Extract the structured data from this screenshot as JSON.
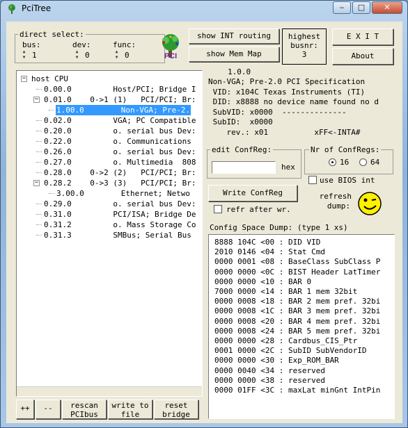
{
  "window": {
    "title": "PciTree",
    "minimize": "‒",
    "maximize": "□",
    "close": "✕"
  },
  "direct_select": {
    "title": "direct select:",
    "bus": {
      "label": "bus:",
      "value": "1"
    },
    "dev": {
      "label": "dev:",
      "value": "0"
    },
    "func": {
      "label": "func:",
      "value": "0"
    }
  },
  "logo_text": "PCI",
  "buttons": {
    "show_int": "show INT routing",
    "show_mem": "show Mem Map",
    "highest_busnr_line1": "highest",
    "highest_busnr_line2": "busnr:",
    "highest_busnr_value": "3",
    "exit": "E X I T",
    "about": "About"
  },
  "tree": [
    {
      "indent": 0,
      "expander": "−",
      "text": "host CPU"
    },
    {
      "indent": 1,
      "text": "0.00.0         Host/PCI; Bridge I"
    },
    {
      "indent": 1,
      "expander": "−",
      "text": "0.01.0    0->1 (1)   PCI/PCI; Br:"
    },
    {
      "indent": 2,
      "text": "1.00.0        Non-VGA; Pre-2.",
      "selected": true
    },
    {
      "indent": 1,
      "text": "0.02.0         VGA; PC Compatible"
    },
    {
      "indent": 1,
      "text": "0.20.0         o. serial bus Dev:"
    },
    {
      "indent": 1,
      "text": "0.22.0         o. Communications"
    },
    {
      "indent": 1,
      "text": "0.26.0         o. serial bus Dev:"
    },
    {
      "indent": 1,
      "text": "0.27.0         o. Multimedia  808"
    },
    {
      "indent": 1,
      "text": "0.28.0    0->2 (2)   PCI/PCI; Br:"
    },
    {
      "indent": 1,
      "expander": "−",
      "text": "0.28.2    0->3 (3)   PCI/PCI; Br:"
    },
    {
      "indent": 2,
      "text": "3.00.0        Ethernet; Netwo"
    },
    {
      "indent": 1,
      "text": "0.29.0         o. serial bus Dev:"
    },
    {
      "indent": 1,
      "text": "0.31.0         PCI/ISA; Bridge De"
    },
    {
      "indent": 1,
      "text": "0.31.2         o. Mass Storage Co"
    },
    {
      "indent": 1,
      "text": "0.31.3         SMBus; Serial Bus"
    }
  ],
  "bottom_buttons": [
    {
      "line1": "++",
      "line2": ""
    },
    {
      "line1": "--",
      "line2": ""
    },
    {
      "line1": "rescan",
      "line2": "PCIbus"
    },
    {
      "line1": "write to",
      "line2": "file"
    },
    {
      "line1": "reset",
      "line2": "bridge"
    }
  ],
  "device_info": {
    "title": "1.0.0",
    "lines": [
      "Non-VGA; Pre-2.0 PCI Specification",
      " VID: x104C Texas Instruments (TI)",
      " DID: x8888 no device name found no d",
      " SubVID: x0000  --------------",
      " SubID:  x0000",
      "    rev.: x01          xFF<-INTA#"
    ]
  },
  "edit_confreg": {
    "title": "edit ConfReg:",
    "value": "",
    "hex_label": "hex"
  },
  "nr_confregs": {
    "title": "Nr of ConfRegs:",
    "option1": "16",
    "option2": "64",
    "selected": "16"
  },
  "write_confreg": "Write ConfReg",
  "refr_after_wr": {
    "label": "refr after wr.",
    "checked": false
  },
  "use_bios_int": {
    "label": "use BIOS int",
    "checked": false
  },
  "refresh_dump": {
    "line1": "refresh",
    "line2": "dump:"
  },
  "dump": {
    "title": "Config Space Dump: (type 1 xs)",
    "rows": [
      "8888 104C <00 : DID VID",
      "2010 0146 <04 : Stat Cmd",
      "0000 0001 <08 : BaseClass SubClass P",
      "0000 0000 <0C : BIST Header LatTimer",
      "0000 0000 <10 : BAR 0",
      "7000 0000 <14 : BAR 1 mem 32bit",
      "0000 0008 <18 : BAR 2 mem pref. 32bi",
      "0000 0008 <1C : BAR 3 mem pref. 32bi",
      "0000 0008 <20 : BAR 4 mem pref. 32bi",
      "0000 0008 <24 : BAR 5 mem pref. 32bi",
      "0000 0000 <28 : Cardbus_CIS_Ptr",
      "0001 0000 <2C : SubID SubVendorID",
      "0000 0000 <30 : Exp_ROM_BAR",
      "0000 0040 <34 : reserved",
      "0000 0000 <38 : reserved",
      "0000 01FF <3C : maxLat minGnt IntPin"
    ]
  }
}
